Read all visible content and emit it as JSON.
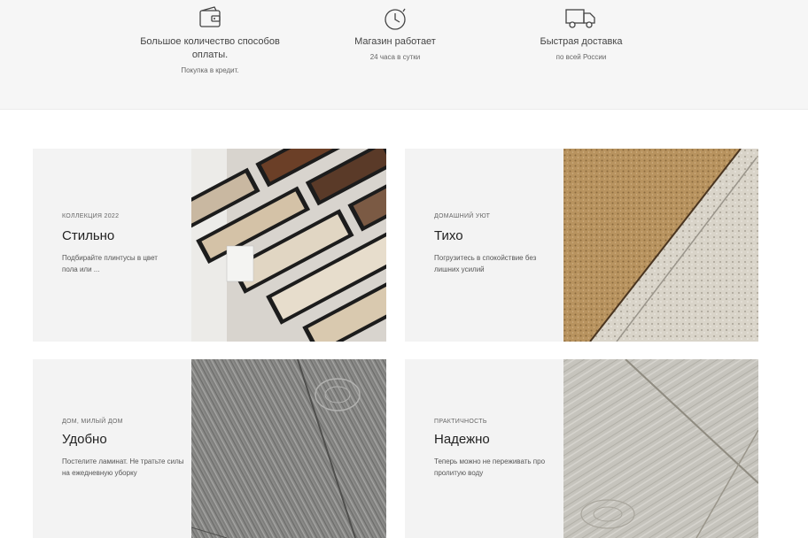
{
  "features": [
    {
      "icon": "wallet-icon",
      "title": "Большое количество способов оплаты.",
      "subtitle": "Покупка в кредит."
    },
    {
      "icon": "clock-icon",
      "title": "Магазин работает",
      "subtitle": "24 часа в сутки"
    },
    {
      "icon": "truck-icon",
      "title": "Быстрая доставка",
      "subtitle": "по всей России"
    }
  ],
  "cards": [
    {
      "caption": "КОЛЛЕКЦИЯ 2022",
      "title": "Стильно",
      "description": "Подбирайте плинтусы в цвет пола или ...",
      "image": "baseboard-samples-image"
    },
    {
      "caption": "ДОМАШНИЙ УЮТ",
      "title": "Тихо",
      "description": "Погрузитесь в спокойствие без лишних усилий",
      "image": "cork-underlay-image"
    },
    {
      "caption": "ДОМ, МИЛЫЙ ДОМ",
      "title": "Удобно",
      "description": "Постелите ламинат. Не тратьте силы на ежедневную уборку",
      "image": "gray-laminate-image"
    },
    {
      "caption": "ПРАКТИЧНОСТЬ",
      "title": "Надежно",
      "description": "Теперь можно не переживать про пролитую воду",
      "image": "light-laminate-image"
    }
  ],
  "colors": {
    "band_background": "#f6f6f6",
    "card_background": "#f3f3f3",
    "heading_text": "#222222"
  }
}
